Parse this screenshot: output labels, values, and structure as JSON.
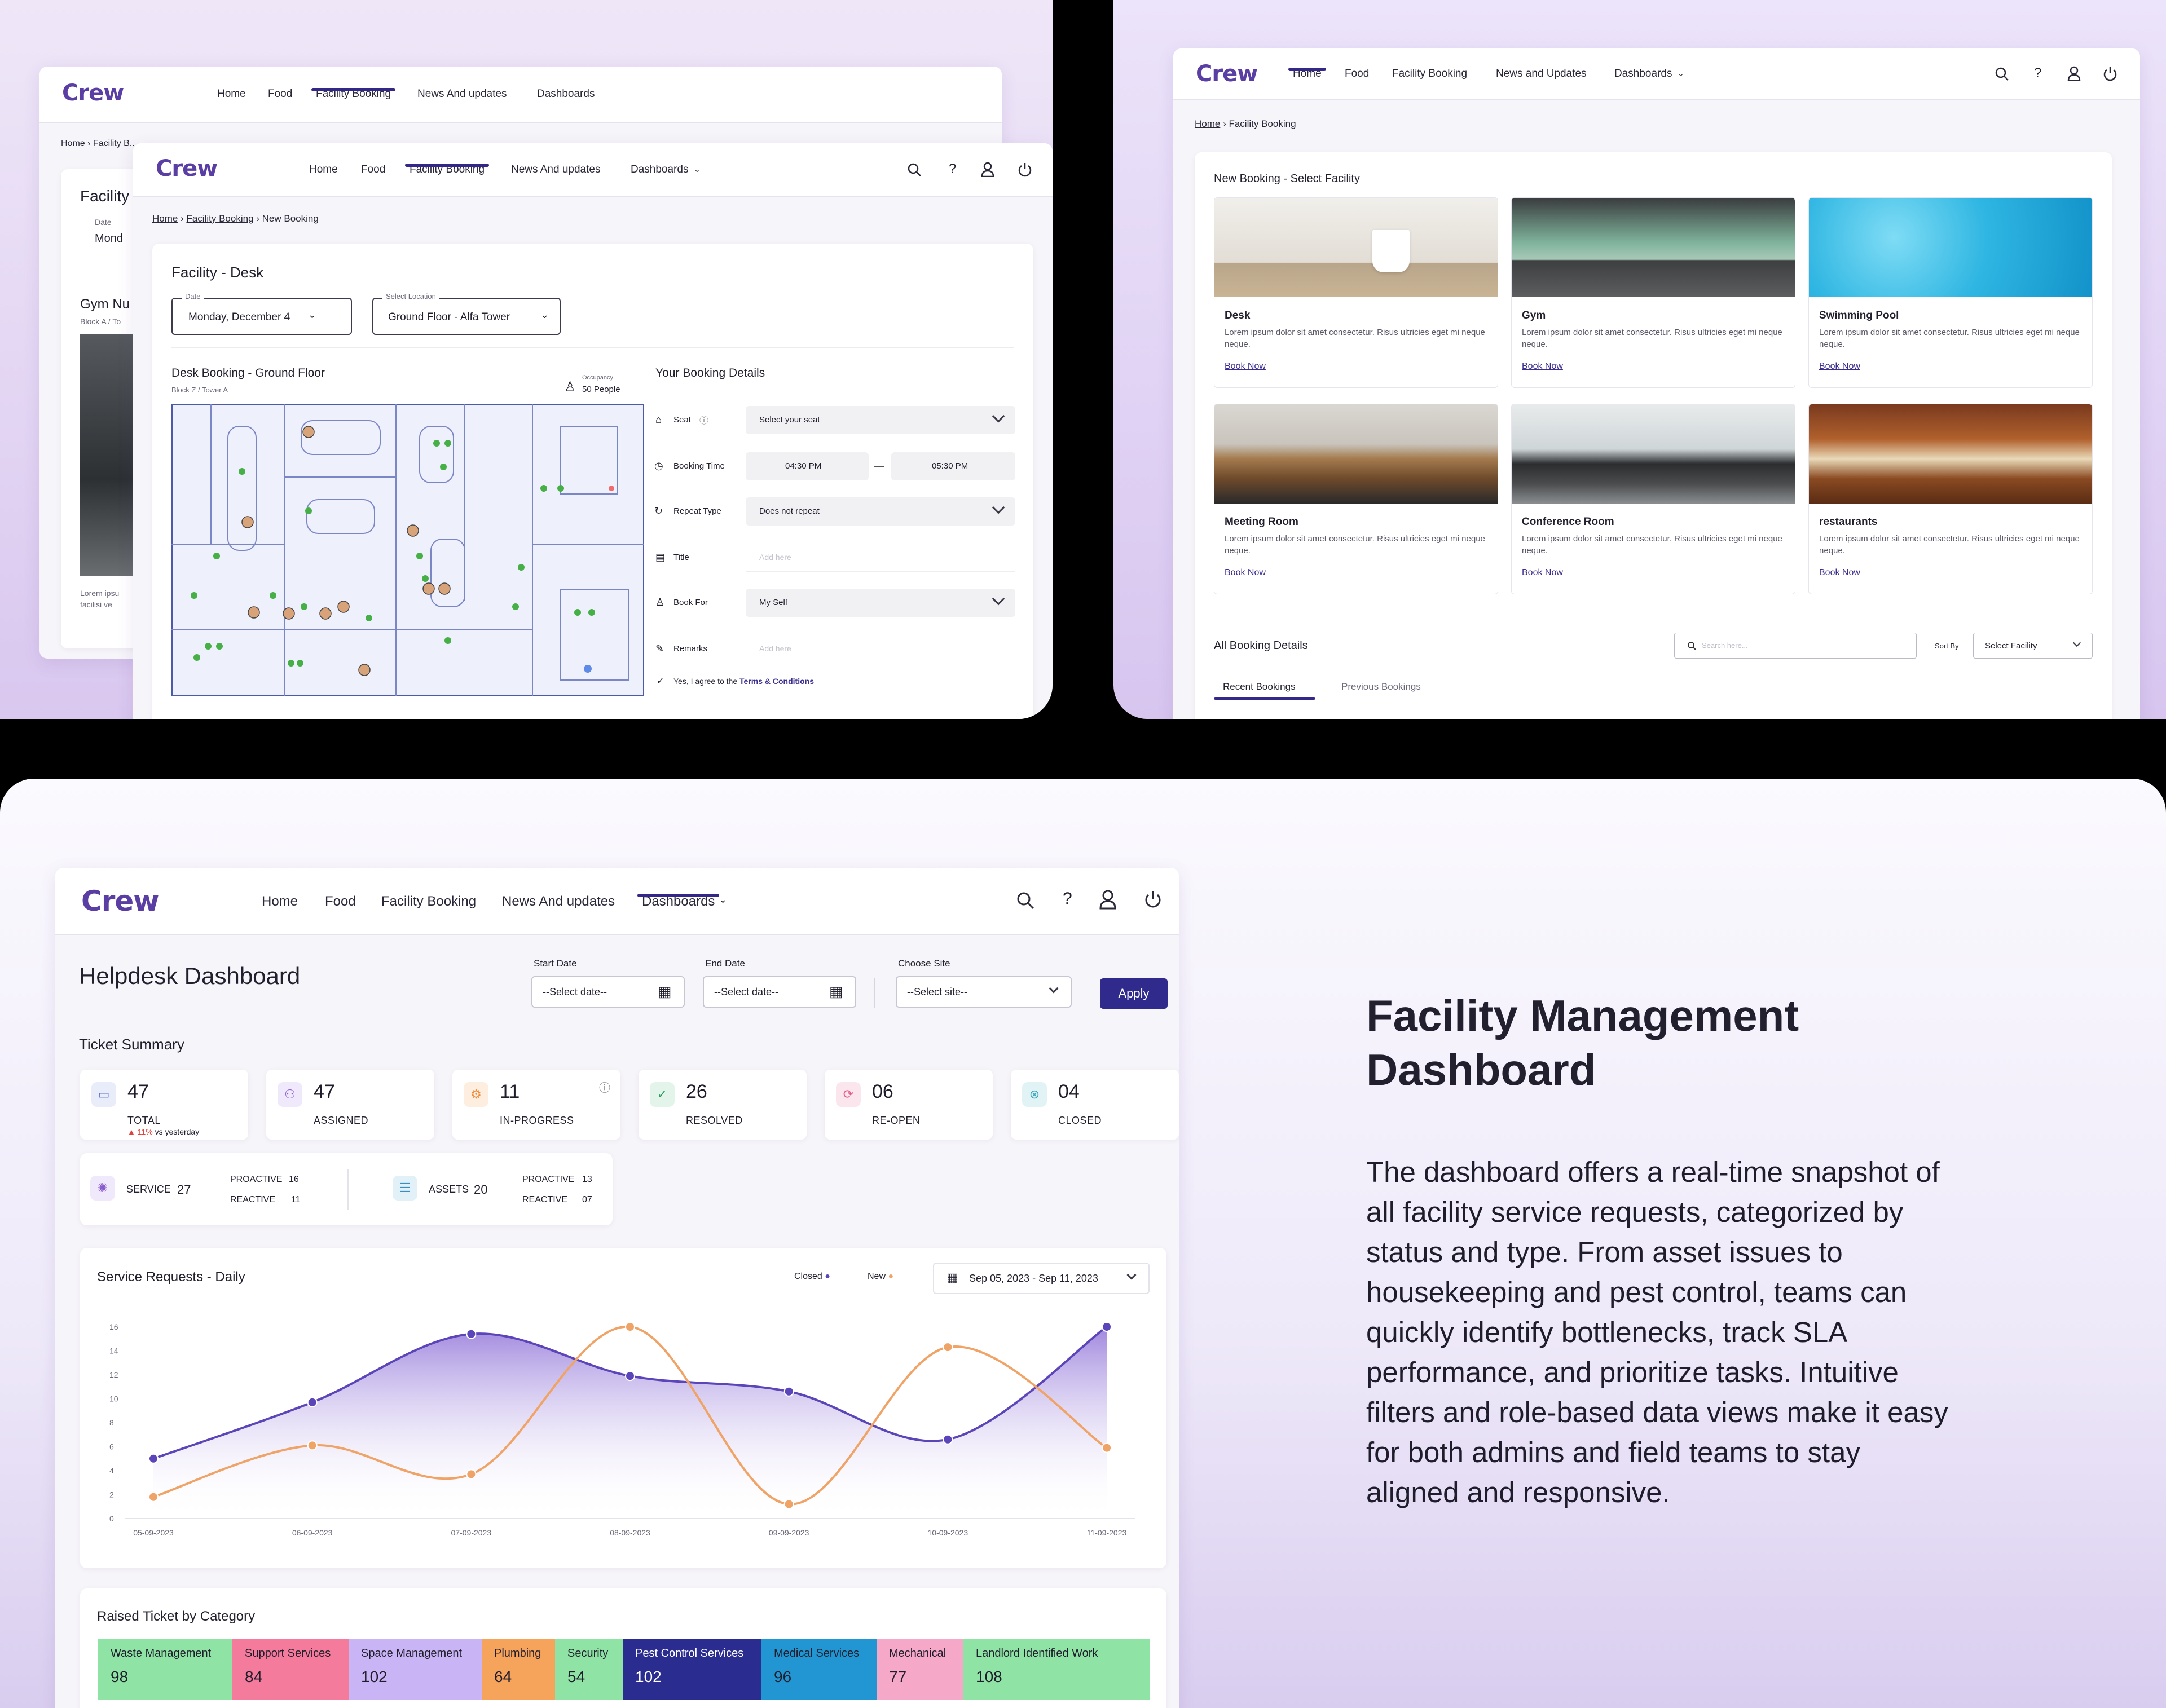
{
  "nav": {
    "logo": "Crew",
    "home": "Home",
    "food": "Food",
    "facility_booking": "Facility Booking",
    "news": "News And updates",
    "news_alt": "News and Updates",
    "dashboards": "Dashboards"
  },
  "desk_booking": {
    "crumb_home": "Home",
    "crumb_facility": "Facility Booking",
    "crumb_new": "New Booking",
    "title": "Facility - Desk",
    "date_label": "Date",
    "date_value": "Monday, December 4",
    "location_label": "Select Location",
    "location_value": "Ground Floor - Alfa Tower",
    "map_title": "Desk Booking - Ground Floor",
    "map_sub": "Block Z / Tower A",
    "occupancy_label": "Occupancy",
    "occupancy_value": "50 People",
    "details_title": "Your Booking Details",
    "seat_label": "Seat",
    "seat_value": "Select your seat",
    "time_label": "Booking Time",
    "time_from": "04:30 PM",
    "time_to": "05:30 PM",
    "repeat_label": "Repeat Type",
    "repeat_value": "Does not repeat",
    "title_label": "Title",
    "title_placeholder": "Add here",
    "bookfor_label": "Book For",
    "bookfor_value": "My Self",
    "remarks_label": "Remarks",
    "remarks_placeholder": "Add here",
    "agree_text": "Yes, I agree to the",
    "terms_link": "Terms & Conditions"
  },
  "back_window": {
    "crumb_home": "Home",
    "crumb_facility": "Facility B...",
    "title": "Facility",
    "date_label": "Date",
    "date_value": "Mond",
    "gym_title": "Gym Nu",
    "gym_sub": "Block A / To",
    "lorem": "Lorem ipsu facilisi ve"
  },
  "select_facility": {
    "crumb_home": "Home",
    "crumb_current": "Facility Booking",
    "title": "New Booking - Select Facility",
    "book_now": "Book Now",
    "facilities": [
      {
        "name": "Desk",
        "desc": "Lorem ipsum dolor sit amet consectetur. Risus ultricies eget mi neque neque."
      },
      {
        "name": "Gym",
        "desc": "Lorem ipsum dolor sit amet consectetur. Risus ultricies eget mi neque neque."
      },
      {
        "name": "Swimming Pool",
        "desc": "Lorem ipsum dolor sit amet consectetur. Risus ultricies eget mi neque neque."
      },
      {
        "name": "Meeting Room",
        "desc": "Lorem ipsum dolor sit amet consectetur. Risus ultricies eget mi neque neque."
      },
      {
        "name": "Conference Room",
        "desc": "Lorem ipsum dolor sit amet consectetur. Risus ultricies eget mi neque neque."
      },
      {
        "name": "restaurants",
        "desc": "Lorem ipsum dolor sit amet consectetur. Risus ultricies eget mi neque neque."
      }
    ],
    "all_bookings": "All Booking Details",
    "search_placeholder": "Search here...",
    "sort_label": "Sort By",
    "sort_value": "Select Facility",
    "tab_recent": "Recent Bookings",
    "tab_previous": "Previous Bookings"
  },
  "helpdesk": {
    "title": "Helpdesk Dashboard",
    "start_label": "Start Date",
    "end_label": "End Date",
    "site_label": "Choose Site",
    "date_placeholder": "--Select date--",
    "site_placeholder": "--Select site--",
    "apply": "Apply",
    "summary_title": "Ticket Summary",
    "stats": [
      {
        "value": "47",
        "label": "TOTAL",
        "color": "#5b6fc4"
      },
      {
        "value": "47",
        "label": "ASSIGNED",
        "color": "#8a5bd0"
      },
      {
        "value": "11",
        "label": "IN-PROGRESS",
        "color": "#f08a3a"
      },
      {
        "value": "26",
        "label": "RESOLVED",
        "color": "#2f9e5a"
      },
      {
        "value": "06",
        "label": "RE-OPEN",
        "color": "#e05a8a"
      },
      {
        "value": "04",
        "label": "CLOSED",
        "color": "#3aa6b9"
      }
    ],
    "trend_value": "11%",
    "trend_text": "vs yesterday",
    "service_label": "SERVICE",
    "service_value": "27",
    "service_proactive_label": "PROACTIVE",
    "service_proactive": "16",
    "service_reactive_label": "REACTIVE",
    "service_reactive": "11",
    "assets_label": "ASSETS",
    "assets_value": "20",
    "assets_proactive_label": "PROACTIVE",
    "assets_proactive": "13",
    "assets_reactive_label": "REACTIVE",
    "assets_reactive": "07",
    "category_title": "Raised Ticket by Category",
    "categories": [
      {
        "name": "Waste Management",
        "value": "98",
        "color": "#8fe3a5"
      },
      {
        "name": "Support Services",
        "value": "84",
        "color": "#f47b9c"
      },
      {
        "name": "Space Management",
        "value": "102",
        "color": "#c9b4f5"
      },
      {
        "name": "Plumbing",
        "value": "64",
        "color": "#f6a35c"
      },
      {
        "name": "Security",
        "value": "54",
        "color": "#8fe3a5"
      },
      {
        "name": "Pest Control Services",
        "value": "102",
        "color": "#2b2c8f"
      },
      {
        "name": "Medical Services",
        "value": "96",
        "color": "#2196d3"
      },
      {
        "name": "Mechanical",
        "value": "77",
        "color": "#f6a8c8"
      },
      {
        "name": "Landlord Identified Work",
        "value": "108",
        "color": "#8fe3a5"
      }
    ]
  },
  "chart_data": {
    "type": "area",
    "title": "Service Requests - Daily",
    "date_range": "Sep 05, 2023 - Sep 11, 2023",
    "x_ticks": [
      "05-09-2023",
      "06-09-2023",
      "07-09-2023",
      "08-09-2023",
      "09-09-2023",
      "10-09-2023",
      "11-09-2023"
    ],
    "y_ticks": [
      "0",
      "2",
      "4",
      "6",
      "8",
      "10",
      "12",
      "14",
      "16"
    ],
    "ylim": [
      0,
      16
    ],
    "grid": false,
    "legend": "top-right",
    "series": [
      {
        "name": "Closed",
        "color": "#5b45b8",
        "x": [
          0,
          1,
          2,
          3,
          4,
          5,
          6
        ],
        "values": [
          5,
          9.7,
          15.4,
          11.9,
          10.6,
          6.6,
          16
        ]
      },
      {
        "name": "New",
        "color": "#f0a366",
        "x": [
          0,
          1,
          2,
          3,
          4,
          5,
          6
        ],
        "values": [
          1.8,
          6.1,
          3.7,
          16,
          1.2,
          14.3,
          5.9
        ]
      }
    ]
  },
  "promo": {
    "title_line1": "Facility Management",
    "title_line2": "Dashboard",
    "body": "The dashboard offers a real-time snapshot of all facility service requests, categorized by status and type. From asset issues to housekeeping and pest control, teams can quickly identify bottlenecks, track SLA performance, and prioritize tasks. Intuitive filters and role-based data views make it easy for both admins and field teams to stay aligned and responsive."
  }
}
